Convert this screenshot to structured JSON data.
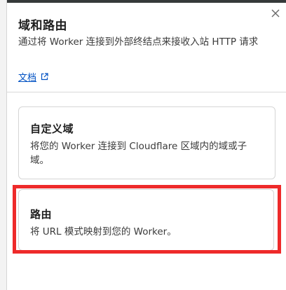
{
  "panel": {
    "title": "域和路由",
    "description": "通过将 Worker 连接到外部终结点来接收入站 HTTP 请求",
    "docs_link": "文档"
  },
  "cards": {
    "custom_domains": {
      "title": "自定义域",
      "description": "将您的 Worker 连接到 Cloudflare 区域内的域或子域。"
    },
    "routes": {
      "title": "路由",
      "description": "将 URL 模式映射到您的 Worker。"
    }
  },
  "colors": {
    "link": "#0051c3",
    "highlight": "#ee2a2a",
    "border": "#d5d5d5"
  },
  "icons": {
    "close": "close-icon",
    "external_link": "external-link-icon"
  }
}
